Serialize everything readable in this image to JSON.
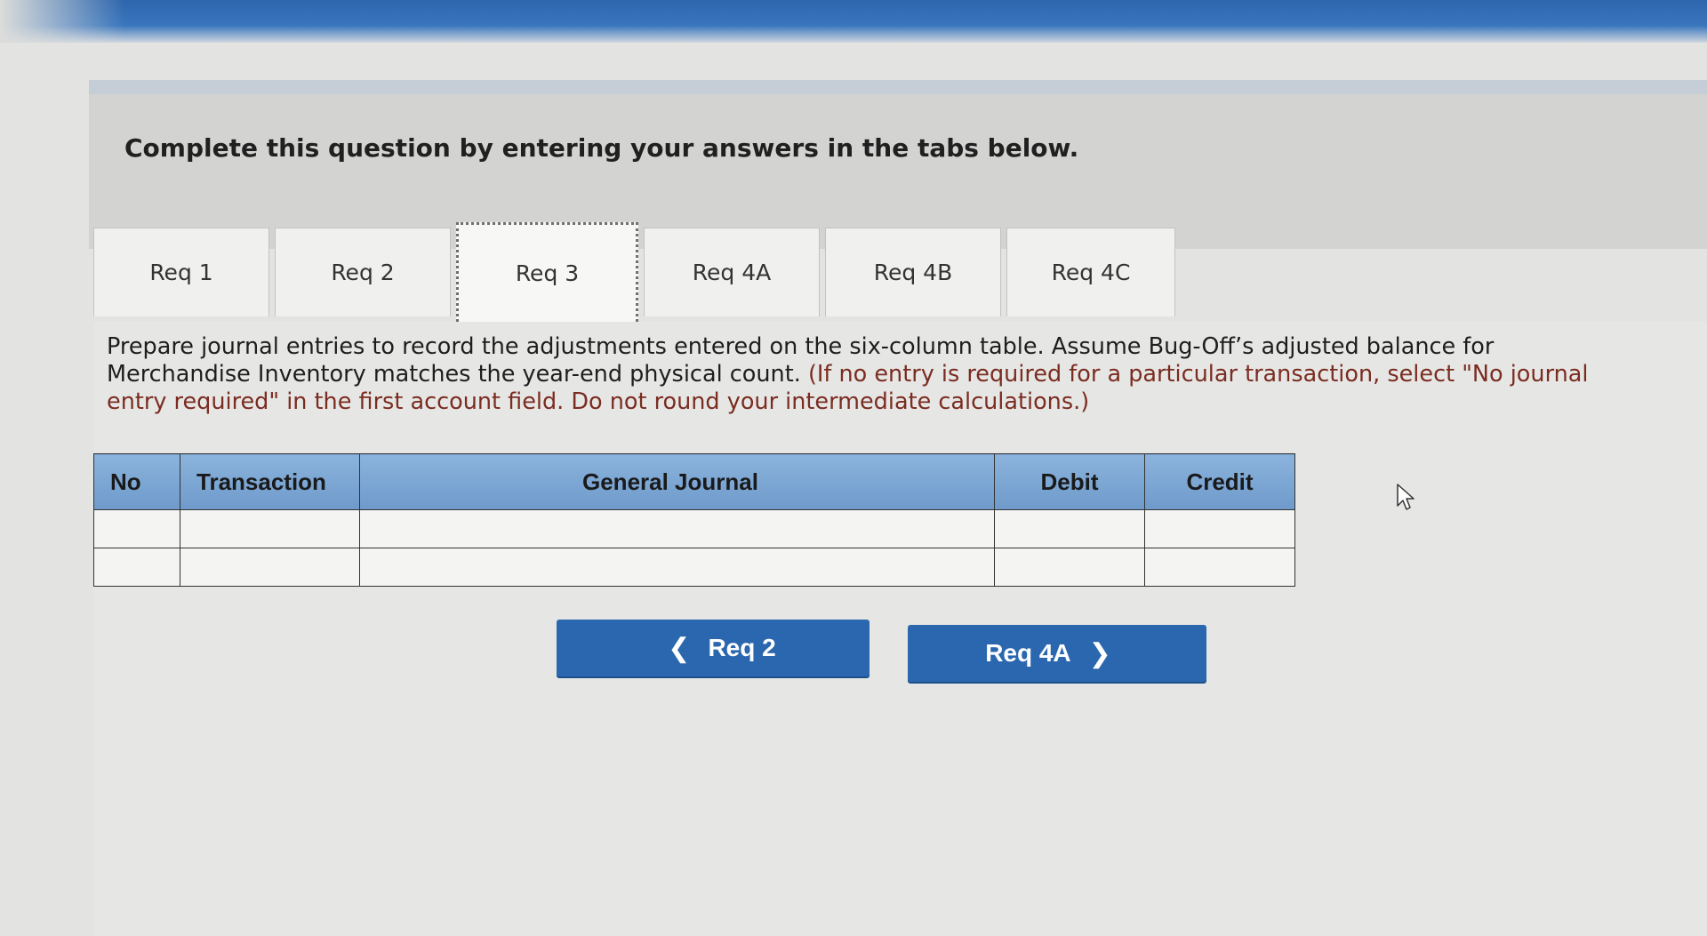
{
  "header": {
    "instruction": "Complete this question by entering your answers in the tabs below."
  },
  "tabs": [
    {
      "label": "Req 1",
      "active": false
    },
    {
      "label": "Req 2",
      "active": false
    },
    {
      "label": "Req 3",
      "active": true
    },
    {
      "label": "Req 4A",
      "active": false
    },
    {
      "label": "Req 4B",
      "active": false
    },
    {
      "label": "Req 4C",
      "active": false
    }
  ],
  "prompt": {
    "main": "Prepare journal entries to record the adjustments entered on the six-column table. Assume Bug-Off’s adjusted balance for Merchandise Inventory matches the year-end physical count.",
    "hint": "(If no entry is required for a particular transaction, select \"No journal entry required\" in the first account field. Do not round your intermediate calculations.)"
  },
  "journal": {
    "headers": {
      "no": "No",
      "transaction": "Transaction",
      "general_journal": "General Journal",
      "debit": "Debit",
      "credit": "Credit"
    },
    "rows": [
      {
        "no": "",
        "transaction": "",
        "account": "",
        "debit": "",
        "credit": ""
      },
      {
        "no": "",
        "transaction": "",
        "account": "",
        "debit": "",
        "credit": ""
      }
    ]
  },
  "navigation": {
    "prev_label": "Req 2",
    "next_label": "Req 4A",
    "prev_icon": "chevron-left-icon",
    "next_icon": "chevron-right-icon",
    "button_color": "#2b67ae"
  }
}
